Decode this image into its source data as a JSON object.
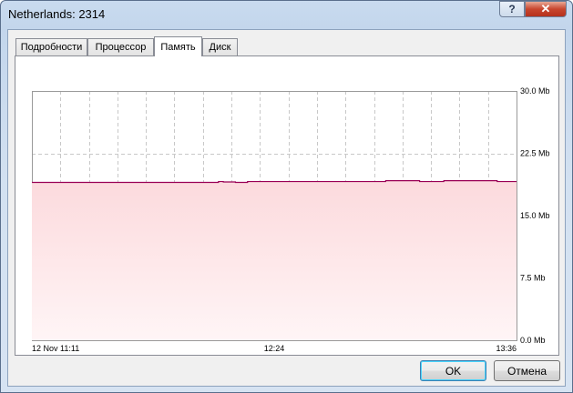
{
  "window": {
    "title": "Netherlands: 2314",
    "help_label": "?",
    "close_label": "✕"
  },
  "tabs": [
    {
      "label": "Подробности",
      "active": false
    },
    {
      "label": "Процессор",
      "active": false
    },
    {
      "label": "Память",
      "active": true
    },
    {
      "label": "Диск",
      "active": false
    }
  ],
  "buttons": {
    "ok": "OK",
    "cancel": "Отмена"
  },
  "colors": {
    "line": "#990055",
    "fill": "#fde3e6"
  },
  "chart_data": {
    "type": "area",
    "grid": true,
    "y_axis_position": "right",
    "ylim": [
      0,
      30
    ],
    "y_tick_labels": [
      "30.0 Mb",
      "22.5 Mb",
      "15.0 Mb",
      "7.5 Mb",
      "0.0 Mb"
    ],
    "y_tick_values": [
      30,
      22.5,
      15,
      7.5,
      0
    ],
    "x_tick_labels": [
      "12 Nov 11:11",
      "12:24",
      "13:36"
    ],
    "x_tick_positions_fraction": [
      0,
      0.5,
      1
    ],
    "series": [
      {
        "x_fraction": [
          0,
          0.37,
          0.385,
          0.395,
          0.42,
          0.445,
          0.7,
          0.73,
          0.8,
          0.85,
          0.93,
          0.96,
          1
        ],
        "values": [
          19.0,
          19.0,
          19.1,
          19.05,
          19.0,
          19.1,
          19.1,
          19.2,
          19.1,
          19.2,
          19.2,
          19.1,
          19.1
        ]
      }
    ]
  }
}
